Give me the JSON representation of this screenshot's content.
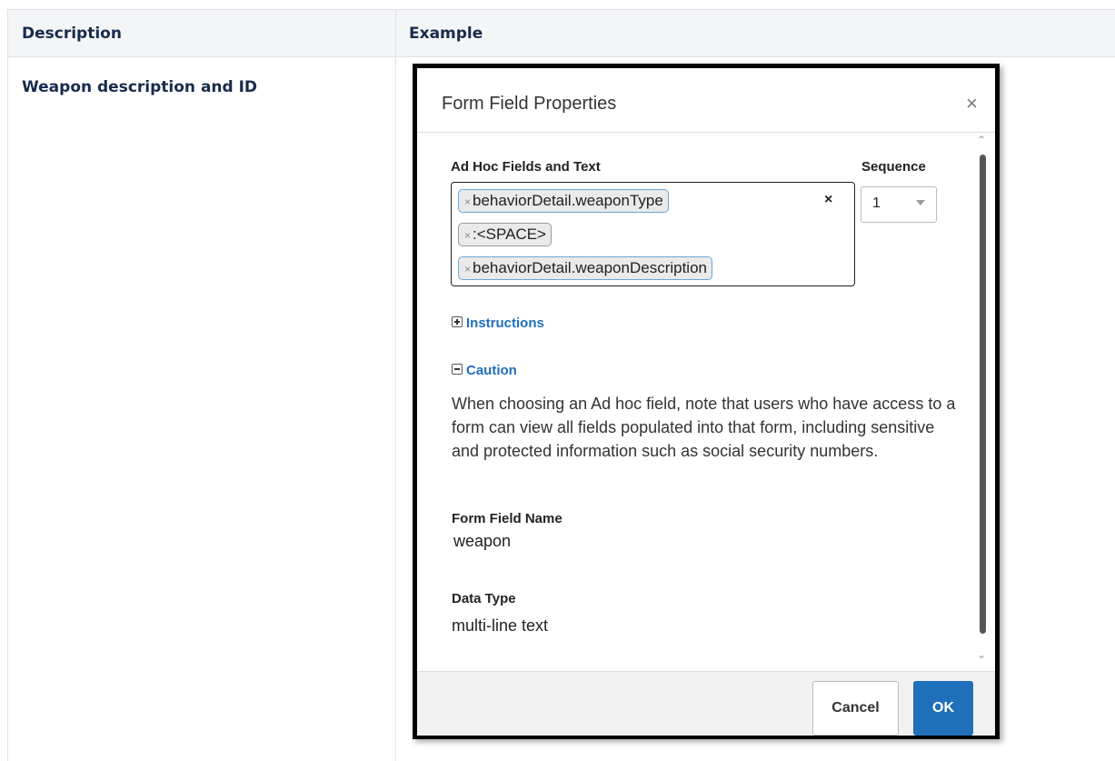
{
  "table": {
    "headers": {
      "description": "Description",
      "example": "Example"
    },
    "rows": [
      {
        "description": "Weapon description and ID"
      }
    ]
  },
  "dialog": {
    "title": "Form Field Properties",
    "close_glyph": "×",
    "ad_hoc_label": "Ad Hoc Fields and Text",
    "tags": [
      {
        "text": "behaviorDetail.weaponType"
      },
      {
        "text": ":<SPACE>"
      },
      {
        "text": "behaviorDetail.weaponDescription"
      }
    ],
    "tag_remove_glyph": "×",
    "clear_glyph": "×",
    "sequence_label": "Sequence",
    "sequence_value": "1",
    "instructions_label": "Instructions",
    "caution_label": "Caution",
    "caution_text": "When choosing an Ad hoc field, note that users who have access to a form can view all fields populated into that form, including sensitive and protected information such as social security numbers.",
    "form_field_name_label": "Form Field Name",
    "form_field_name_value": "weapon",
    "data_type_label": "Data Type",
    "data_type_value": "multi-line text",
    "buttons": {
      "cancel": "Cancel",
      "ok": "OK"
    }
  },
  "colors": {
    "accent": "#1f6fba",
    "header_bg": "#f4f5f7",
    "tag_border": "#6aa7d8"
  }
}
